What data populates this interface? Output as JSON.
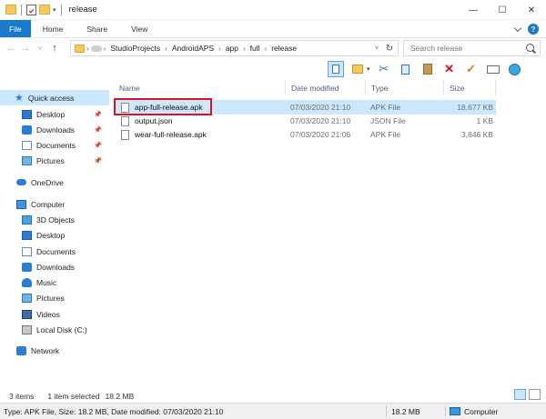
{
  "window": {
    "title": "release",
    "controls": {
      "minimize": "—",
      "maximize": "☐",
      "close": "✕"
    }
  },
  "ribbon": {
    "tabs": [
      "File",
      "Home",
      "Share",
      "View"
    ],
    "help": "?"
  },
  "address": {
    "back": "←",
    "forward": "→",
    "recent": "˅",
    "up": "↑",
    "crumbs": [
      "StudioProjects",
      "AndroidAPS",
      "app",
      "full",
      "release"
    ],
    "separator": "›",
    "refresh": "↻",
    "dropdown": "˅"
  },
  "search": {
    "placeholder": "Search release"
  },
  "nav": {
    "items": [
      {
        "label": "Quick access",
        "icon": "star-icon"
      },
      {
        "label": "Desktop",
        "icon": "desktop-icon",
        "pinned": true
      },
      {
        "label": "Downloads",
        "icon": "downloads-icon",
        "pinned": true
      },
      {
        "label": "Documents",
        "icon": "documents-icon",
        "pinned": true
      },
      {
        "label": "Pictures",
        "icon": "pictures-icon",
        "pinned": true
      },
      {
        "label": "OneDrive",
        "icon": "onedrive-icon"
      },
      {
        "label": "Computer",
        "icon": "computer-icon"
      },
      {
        "label": "3D Objects",
        "icon": "3d-objects-icon"
      },
      {
        "label": "Desktop",
        "icon": "desktop-icon"
      },
      {
        "label": "Documents",
        "icon": "documents-icon"
      },
      {
        "label": "Downloads",
        "icon": "downloads-icon"
      },
      {
        "label": "Music",
        "icon": "music-icon"
      },
      {
        "label": "Pictures",
        "icon": "pictures-icon"
      },
      {
        "label": "Videos",
        "icon": "videos-icon"
      },
      {
        "label": "Local Disk (C:)",
        "icon": "local-disk-icon"
      },
      {
        "label": "Network",
        "icon": "network-icon"
      }
    ]
  },
  "columns": {
    "name": "Name",
    "date": "Date modified",
    "type": "Type",
    "size": "Size"
  },
  "files": [
    {
      "name": "app-full-release.apk",
      "date": "07/03/2020 21:10",
      "type": "APK File",
      "size": "18,677 KB",
      "selected": true
    },
    {
      "name": "output.json",
      "date": "07/03/2020 21:10",
      "type": "JSON File",
      "size": "1 KB",
      "selected": false
    },
    {
      "name": "wear-full-release.apk",
      "date": "07/03/2020 21:06",
      "type": "APK File",
      "size": "3,846 KB",
      "selected": false
    }
  ],
  "status": {
    "item_count": "3 items",
    "selected": "1 item selected",
    "selected_size": "18.2 MB"
  },
  "bottom": {
    "details": "Type: APK File, Size: 18.2 MB, Date modified: 07/03/2020 21:10",
    "size": "18.2 MB",
    "location": "Computer"
  },
  "colors": {
    "accent": "#1979ca",
    "selection": "#cce8ff",
    "highlight_box": "#e0101e"
  }
}
